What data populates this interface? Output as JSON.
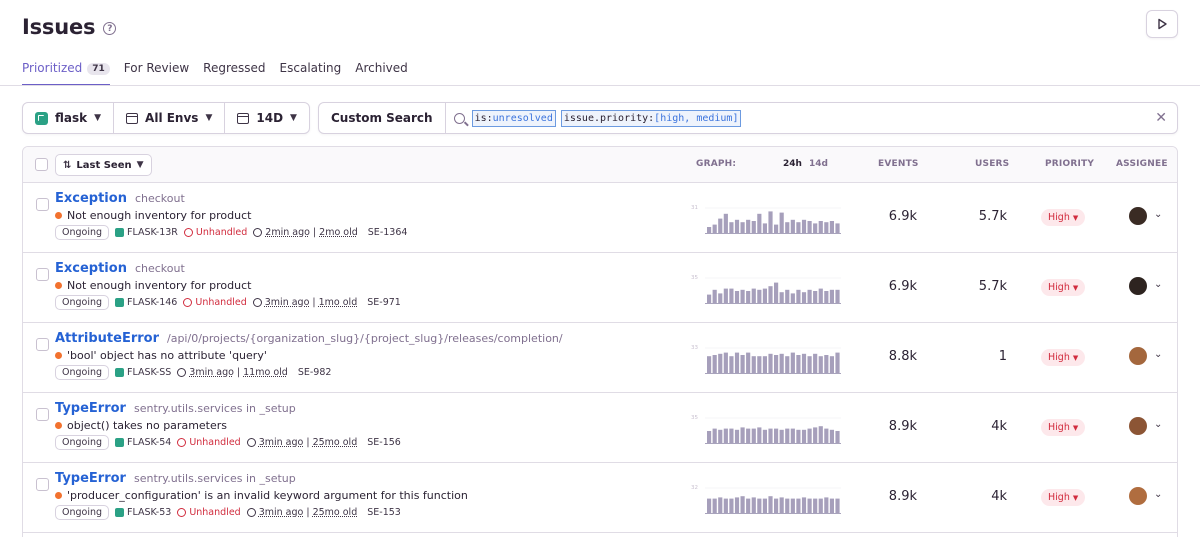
{
  "header": {
    "title": "Issues",
    "help_icon": "question-circle-icon",
    "play_icon": "play-icon"
  },
  "tabs": [
    {
      "label": "Prioritized",
      "count": "71",
      "active": true
    },
    {
      "label": "For Review"
    },
    {
      "label": "Regressed"
    },
    {
      "label": "Escalating"
    },
    {
      "label": "Archived"
    }
  ],
  "filters": {
    "project": "flask",
    "environment": "All Envs",
    "date_range": "14D",
    "custom_search_label": "Custom Search",
    "query_tokens": [
      {
        "key": "is:",
        "value": "unresolved"
      },
      {
        "key": "issue.priority:",
        "value": "[high, medium]"
      }
    ]
  },
  "table": {
    "sort_label": "Last Seen",
    "graph_label": "GRAPH:",
    "graph_tabs": [
      "24h",
      "14d"
    ],
    "columns": {
      "events": "EVENTS",
      "users": "USERS",
      "priority": "PRIORITY",
      "assignee": "ASSIGNEE"
    }
  },
  "issues": [
    {
      "type": "Exception",
      "culprit": "checkout",
      "message": "Not enough inventory for product",
      "status": "Ongoing",
      "short_id": "FLASK-13R",
      "unhandled": "Unhandled",
      "last_seen": "2min ago",
      "first_seen": "2mo old",
      "link": "SE-1364",
      "graph_max": "31",
      "events": "6.9k",
      "users": "5.7k",
      "priority": "High",
      "avatar_color": "#3a2b24",
      "bars": [
        0.25,
        0.35,
        0.6,
        0.8,
        0.45,
        0.55,
        0.45,
        0.55,
        0.5,
        0.8,
        0.4,
        0.9,
        0.35,
        0.85,
        0.45,
        0.55,
        0.45,
        0.55,
        0.5,
        0.4,
        0.5,
        0.45,
        0.5,
        0.4
      ]
    },
    {
      "type": "Exception",
      "culprit": "checkout",
      "message": "Not enough inventory for product",
      "status": "Ongoing",
      "short_id": "FLASK-146",
      "unhandled": "Unhandled",
      "last_seen": "3min ago",
      "first_seen": "1mo old",
      "link": "SE-971",
      "graph_max": "35",
      "events": "6.9k",
      "users": "5.7k",
      "priority": "High",
      "avatar_color": "#2e2420",
      "bars": [
        0.35,
        0.55,
        0.4,
        0.6,
        0.6,
        0.5,
        0.55,
        0.5,
        0.6,
        0.55,
        0.6,
        0.7,
        0.85,
        0.45,
        0.55,
        0.4,
        0.55,
        0.45,
        0.55,
        0.5,
        0.6,
        0.5,
        0.55,
        0.55
      ]
    },
    {
      "type": "AttributeError",
      "culprit": "/api/0/projects/{organization_slug}/{project_slug}/releases/completion/",
      "message": "'bool' object has no attribute 'query'",
      "status": "Ongoing",
      "short_id": "FLASK-SS",
      "unhandled": "",
      "last_seen": "3min ago",
      "first_seen": "11mo old",
      "link": "SE-982",
      "graph_max": "33",
      "events": "8.8k",
      "users": "1",
      "priority": "High",
      "avatar_color": "#a4673d",
      "bars": [
        0.7,
        0.75,
        0.8,
        0.85,
        0.7,
        0.85,
        0.75,
        0.85,
        0.7,
        0.7,
        0.7,
        0.8,
        0.75,
        0.8,
        0.7,
        0.85,
        0.75,
        0.8,
        0.7,
        0.8,
        0.7,
        0.75,
        0.7,
        0.85
      ]
    },
    {
      "type": "TypeError",
      "culprit": "sentry.utils.services in _setup",
      "message": "object() takes no parameters",
      "status": "Ongoing",
      "short_id": "FLASK-54",
      "unhandled": "Unhandled",
      "last_seen": "3min ago",
      "first_seen": "25mo old",
      "link": "SE-156",
      "graph_max": "35",
      "events": "8.9k",
      "users": "4k",
      "priority": "High",
      "avatar_color": "#8c5535",
      "bars": [
        0.5,
        0.6,
        0.55,
        0.6,
        0.6,
        0.55,
        0.65,
        0.6,
        0.6,
        0.65,
        0.55,
        0.6,
        0.6,
        0.55,
        0.6,
        0.6,
        0.55,
        0.55,
        0.6,
        0.65,
        0.7,
        0.6,
        0.55,
        0.5
      ]
    },
    {
      "type": "TypeError",
      "culprit": "sentry.utils.services in _setup",
      "message": "'producer_configuration' is an invalid keyword argument for this function",
      "status": "Ongoing",
      "short_id": "FLASK-53",
      "unhandled": "Unhandled",
      "last_seen": "3min ago",
      "first_seen": "25mo old",
      "link": "SE-153",
      "graph_max": "32",
      "events": "8.9k",
      "users": "4k",
      "priority": "High",
      "avatar_color": "#b06d3f",
      "bars": [
        0.6,
        0.6,
        0.65,
        0.6,
        0.6,
        0.65,
        0.7,
        0.6,
        0.65,
        0.6,
        0.6,
        0.7,
        0.6,
        0.65,
        0.6,
        0.6,
        0.6,
        0.65,
        0.6,
        0.6,
        0.6,
        0.65,
        0.6,
        0.6
      ]
    }
  ]
}
